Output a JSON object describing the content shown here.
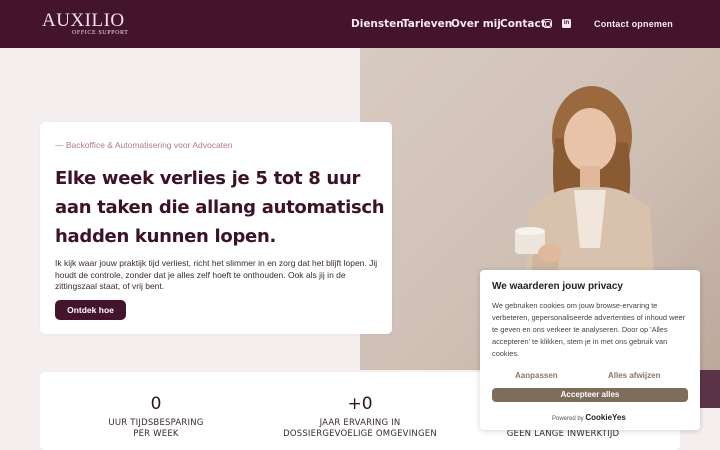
{
  "header": {
    "logo_main": "AUXILIO",
    "logo_sub": "OFFICE SUPPORT",
    "nav": [
      "Diensten",
      "Tarieven",
      "Over mij",
      "Contact"
    ],
    "social": [
      "instagram-icon",
      "linkedin-icon"
    ],
    "linkedin_glyph": "in",
    "contact_button": "Contact opnemen"
  },
  "hero": {
    "eyebrow": "— Backoffice & Automatisering voor Advocaten",
    "headline": "Elke week verlies je 5 tot 8 uur aan taken die allang automatisch hadden kunnen lopen.",
    "body": "Ik kijk waar jouw praktijk tijd verliest, richt het slimmer in en zorg dat het blijft lopen. Jij houdt de controle, zonder dat je alles zelf hoeft te onthouden. Ook als jij in de zittingszaal staat, of vrij bent.",
    "cta": "Ontdek hoe"
  },
  "stats": [
    {
      "number": "0",
      "label_line1": "UUR TIJDSBESPARING",
      "label_line2": "PER WEEK"
    },
    {
      "number": "+0",
      "label_line1": "JAAR ERVARING IN",
      "label_line2": "DOSSIERGEVOELIGE OMGEVINGEN"
    },
    {
      "number": "",
      "label_line1": "",
      "label_line2": "GEEN LANGE INWERKTIJD"
    }
  ],
  "cookie": {
    "title": "We waarderen jouw privacy",
    "text": "We gebruiken cookies om jouw browse-ervaring te verbeteren, gepersonaliseerde advertenties of inhoud weer te geven en ons verkeer te analyseren. Door op 'Alles accepteren' te klikken, stem je in met ons gebruik van cookies.",
    "customize": "Aanpassen",
    "reject": "Alles afwijzen",
    "accept": "Accepteer alles",
    "powered_by": "Powered by",
    "brand": "CookieYes"
  },
  "colors": {
    "brand": "#44142d",
    "page_bg": "#f5eeef",
    "cookie_accent": "#7f6d5b"
  }
}
